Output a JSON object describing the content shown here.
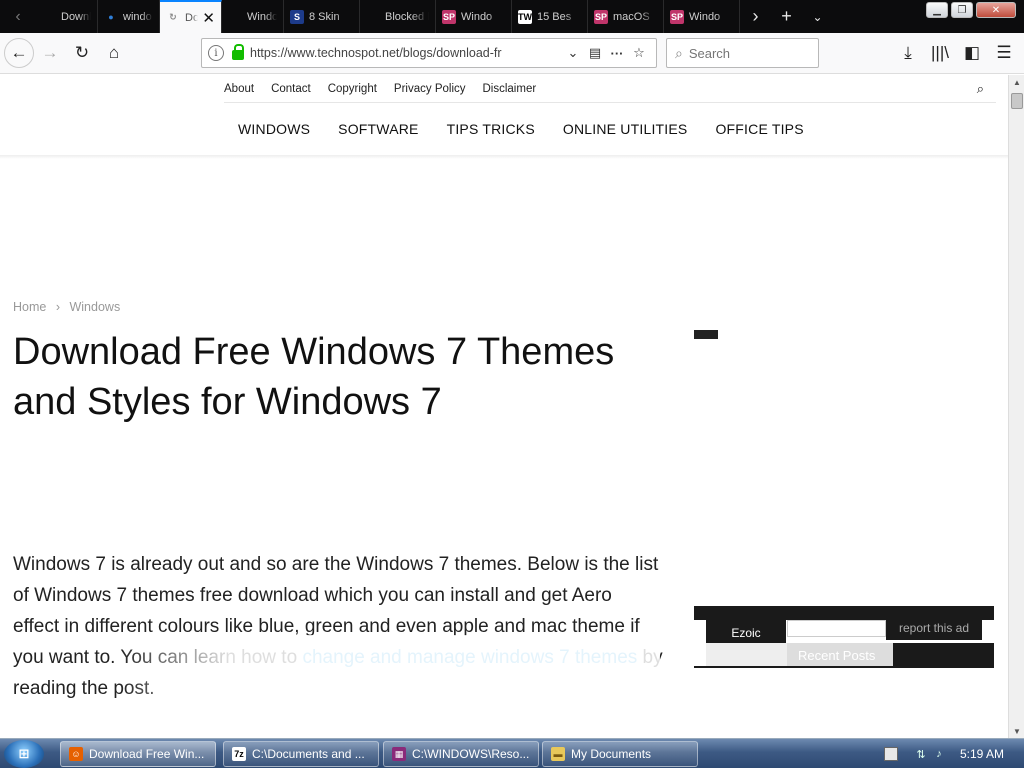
{
  "browser": {
    "tabs": [
      {
        "title": "Downl",
        "favicon": "blank",
        "active": false
      },
      {
        "title": "windo",
        "favicon": "blue-dot",
        "active": false
      },
      {
        "title": "Do",
        "favicon": "loading",
        "active": true
      },
      {
        "title": "Windo",
        "favicon": "blank",
        "active": false
      },
      {
        "title": "8 Skin",
        "favicon": "s-logo",
        "active": false
      },
      {
        "title": "Blocked by",
        "favicon": "blank",
        "active": false
      },
      {
        "title": "Windo",
        "favicon": "sp-logo",
        "active": false
      },
      {
        "title": "15 Bes",
        "favicon": "tw-logo",
        "active": false
      },
      {
        "title": "macOS",
        "favicon": "sp-logo",
        "active": false
      },
      {
        "title": "Windo",
        "favicon": "sp-logo",
        "active": false
      }
    ],
    "url": "https://www.technospot.net/blogs/download-fr",
    "url_domain": "www.technospot.net",
    "search_placeholder": "Search",
    "accent": "#0a84ff",
    "lock_color": "#12bc00"
  },
  "site": {
    "top_links": [
      "About",
      "Contact",
      "Copyright",
      "Privacy Policy",
      "Disclaimer"
    ],
    "main_nav": [
      "WINDOWS",
      "SOFTWARE",
      "TIPS TRICKS",
      "ONLINE UTILITIES",
      "OFFICE TIPS"
    ],
    "breadcrumb": [
      "Home",
      "›",
      "Windows"
    ],
    "title": "Download Free Windows 7 Themes and Styles for Windows 7",
    "body_parts": [
      {
        "text": "Windows 7 is already out and so are the Windows 7 themes. Below is the list of  Windows 7 themes free download which you can install and get Aero effect in different colours like blue, green and even apple and mac theme if you want to. You can learn how to ",
        "link": false
      },
      {
        "text": "change and manage windows 7 themes",
        "link": true
      },
      {
        "text": " by reading the post.",
        "link": false
      }
    ],
    "link_color": "#4db2ec",
    "ad": {
      "ezoic_label": "Ezoic",
      "report_label": "report this ad",
      "recent_posts": "Recent Posts"
    }
  },
  "taskbar": {
    "items": [
      {
        "label": "Download Free Win...",
        "icon": "firefox-icon",
        "active": true
      },
      {
        "label": "C:\\Documents and ...",
        "icon": "7zip-icon",
        "active": false
      },
      {
        "label": "C:\\WINDOWS\\Reso...",
        "icon": "archive-icon",
        "active": false
      },
      {
        "label": "My Documents",
        "icon": "folder-icon",
        "active": false
      }
    ],
    "clock": "5:19 AM"
  }
}
